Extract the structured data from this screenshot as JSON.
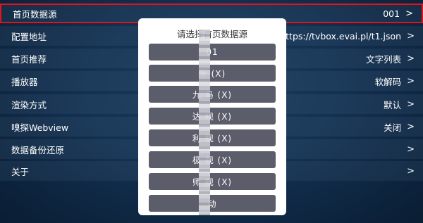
{
  "settings": [
    {
      "label": "首页数据源",
      "value": "001",
      "chevron": ">"
    },
    {
      "label": "配置地址",
      "value": "https://tvbox.evai.pl/t1.json",
      "chevron": ">"
    },
    {
      "label": "首页推荐",
      "value": "文字列表",
      "chevron": ">"
    },
    {
      "label": "播放器",
      "value": "软解码",
      "chevron": ">"
    },
    {
      "label": "渲染方式",
      "value": "默认",
      "chevron": ">"
    },
    {
      "label": "嗅探Webview",
      "value": "关闭",
      "chevron": ">"
    },
    {
      "label": "数据备份还原",
      "value": "",
      "chevron": ">"
    },
    {
      "label": "关于",
      "value": "",
      "chevron": ">"
    }
  ],
  "dialog": {
    "title": "请选择首页数据源",
    "options": [
      "01",
      "乐 (X)",
      "九 马 (X)",
      "达 视 (X)",
      "利 视 (X)",
      "极 视 (X)",
      "师 视 (X)",
      "动 "
    ]
  },
  "colors": {
    "highlight": "#e0141e",
    "dialog_bg": "#ffffff",
    "option_bg": "#5b5d6b"
  }
}
